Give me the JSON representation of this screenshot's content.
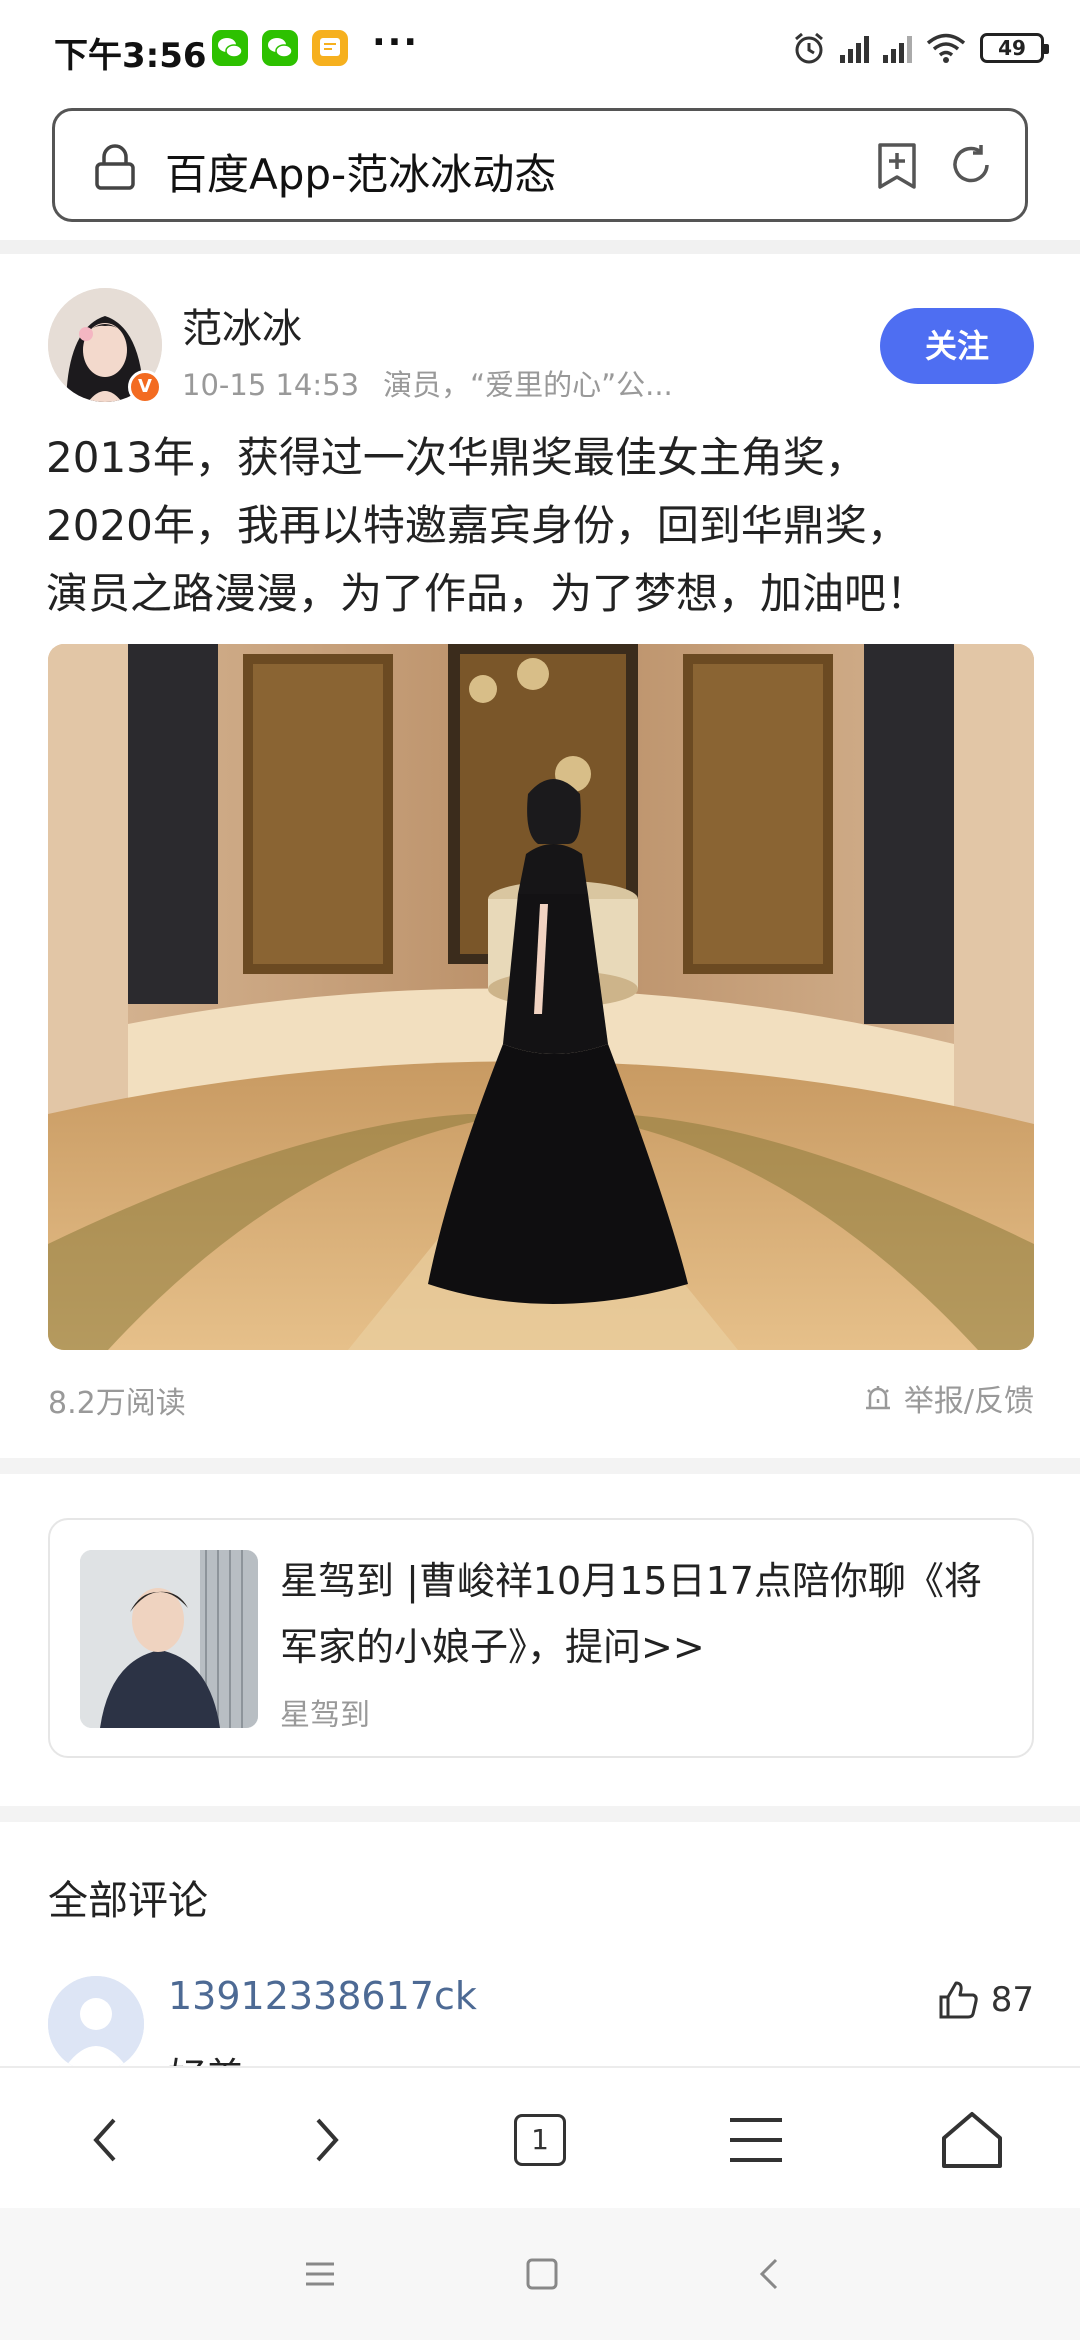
{
  "status_bar": {
    "time": "下午3:56",
    "notification_icons": [
      "wechat-icon",
      "wechat-icon",
      "note-icon"
    ],
    "more": "···",
    "battery": "49"
  },
  "address_bar": {
    "title": "百度App-范冰冰动态"
  },
  "post": {
    "author": "范冰冰",
    "time": "10-15 14:53",
    "description": "演员，“爱里的心”公...",
    "follow_label": "关注",
    "text_lines": [
      "2013年，获得过一次华鼎奖最佳女主角奖，",
      "2020年，我再以特邀嘉宾身份，回到华鼎奖，",
      "演员之路漫漫，为了作品，为了梦想，加油吧！"
    ],
    "reads": "8.2万阅读",
    "report_label": "举报/反馈"
  },
  "card": {
    "title": "星驾到 |曹峻祥10月15日17点陪你聊《将军家的小娘子》，提问>>",
    "source": "星驾到"
  },
  "comments": {
    "header": "全部评论",
    "first": {
      "user": "13912338617ck",
      "likes": "87",
      "text": "好美"
    }
  },
  "toolbar": {
    "tab_count": "1"
  },
  "colors": {
    "follow_button": "#4e6ef2",
    "commenter_name": "#4d6a94",
    "v_badge": "#f36b21"
  }
}
